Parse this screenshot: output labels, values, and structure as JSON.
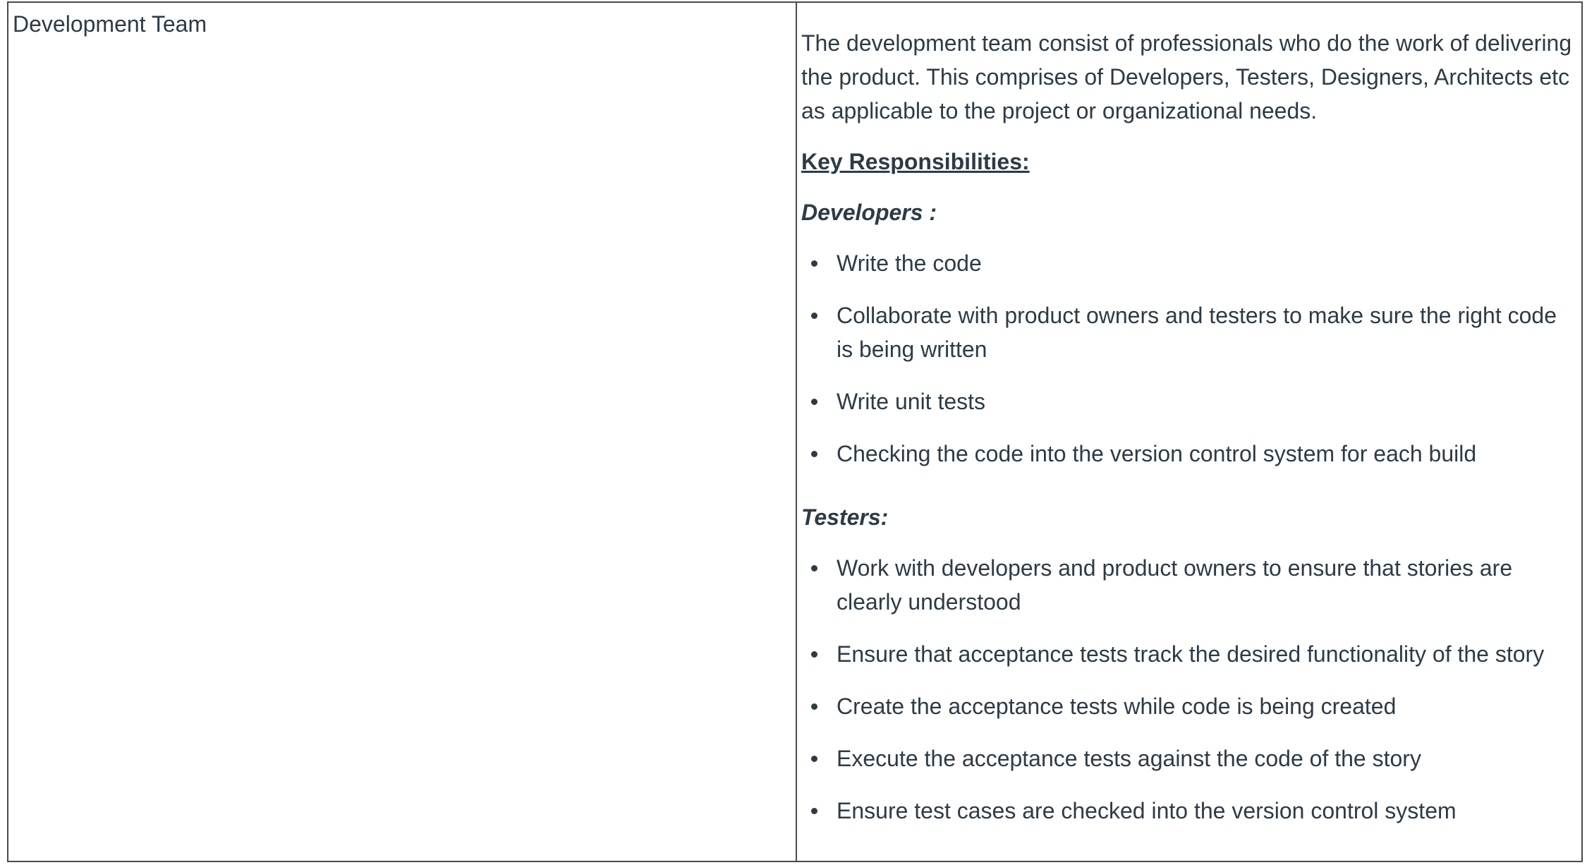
{
  "table": {
    "left_cell": {
      "role": "Development Team"
    },
    "right_cell": {
      "intro": "The development team consist of  professionals who do the work of delivering the product. This comprises of Developers, Testers,  Designers, Architects etc as applicable to the project or organizational needs.",
      "key_heading": "Key Responsibilities:",
      "developers": {
        "heading": "Developers :",
        "items": [
          "Write the code",
          "Collaborate with product owners and testers to make sure the right code is being written",
          "Write unit tests",
          "Checking the code into the version control system for each build"
        ]
      },
      "testers": {
        "heading": "Testers:",
        "items": [
          "Work with developers and product owners to ensure that stories are clearly understood",
          "Ensure that acceptance tests track the desired functionality of the story",
          "Create the acceptance tests while code is being created",
          "Execute the acceptance tests against the code of the story",
          "Ensure test cases are checked into the version control system"
        ]
      }
    }
  }
}
